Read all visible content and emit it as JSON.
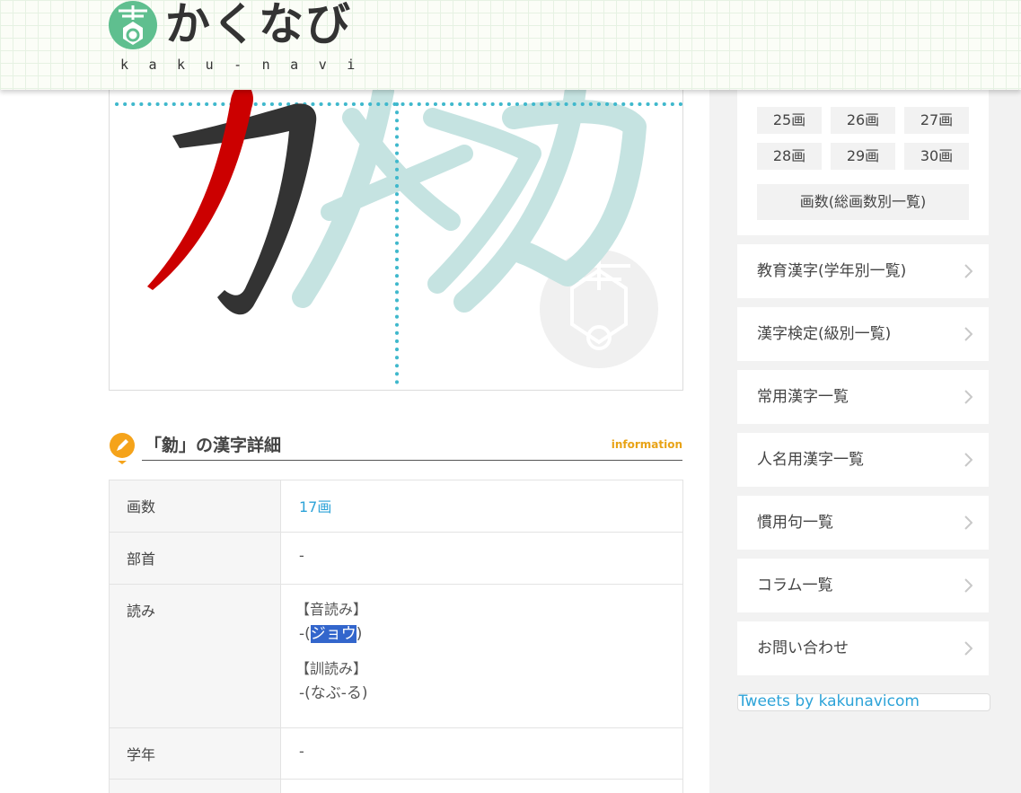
{
  "header": {
    "logo_text": "かくなび",
    "logo_sub": "kaku-navi"
  },
  "kanji_panel": {
    "glyph": "勨",
    "stroke_step": "current stroke highlighted in red"
  },
  "section": {
    "title": "「勨」の漢字詳細",
    "info": "information"
  },
  "details": {
    "strokes_label": "画数",
    "strokes_value": "17画",
    "radical_label": "部首",
    "radical_value": "-",
    "reading_label": "読み",
    "on_head": "【音読み】",
    "on_prefix": "-(",
    "on_reading": "ジョウ",
    "on_suffix": ")",
    "kun_head": "【訓読み】",
    "kun_value": "-(なぶ-る)",
    "grade_label": "学年",
    "grade_value": "-"
  },
  "sidebar": {
    "stroke_buttons": [
      "25画",
      "26画",
      "27画",
      "28画",
      "29画",
      "30画"
    ],
    "stroke_all": "画数(総画数別一覧)",
    "menu": [
      "教育漢字(学年別一覧)",
      "漢字検定(級別一覧)",
      "常用漢字一覧",
      "人名用漢字一覧",
      "慣用句一覧",
      "コラム一覧",
      "お問い合わせ"
    ],
    "tweets": "Tweets by kakunavicom"
  },
  "colors": {
    "accent_blue": "#2da3d8",
    "highlight_red": "#cc0000",
    "guide_dots": "#3fb8cc",
    "ghost_stroke": "#c5e3e1",
    "info_orange": "#e8a317"
  }
}
